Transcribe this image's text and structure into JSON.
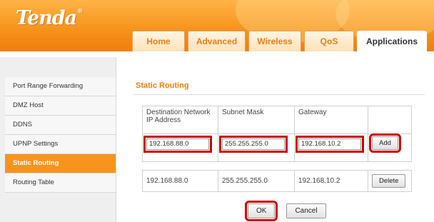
{
  "brand": {
    "logo": "Tenda",
    "registered": "®"
  },
  "nav": {
    "tabs": [
      {
        "label": "Home"
      },
      {
        "label": "Advanced"
      },
      {
        "label": "Wireless"
      },
      {
        "label": "QoS"
      },
      {
        "label": "Applications"
      }
    ],
    "active": "Applications"
  },
  "sidebar": {
    "items": [
      {
        "label": "Port Range Forwarding"
      },
      {
        "label": "DMZ Host"
      },
      {
        "label": "DDNS"
      },
      {
        "label": "UPNP Settings"
      },
      {
        "label": "Static Routing"
      },
      {
        "label": "Routing Table"
      }
    ],
    "active": "Static Routing"
  },
  "main": {
    "title": "Static Routing",
    "form": {
      "headers": [
        "Destination Network IP Address",
        "Subnet Mask",
        "Gateway",
        ""
      ],
      "dest_value": "192.168.88.0",
      "mask_value": "255.255.255.0",
      "gateway_value": "192.168.10.2",
      "add_label": "Add"
    },
    "routes": [
      {
        "dest": "192.168.88.0",
        "mask": "255.255.255.0",
        "gateway": "192.168.10.2",
        "action": "Delete"
      }
    ],
    "ok_label": "OK",
    "cancel_label": "Cancel"
  },
  "colors": {
    "accent": "#f7941d",
    "highlight": "#cc0000"
  }
}
